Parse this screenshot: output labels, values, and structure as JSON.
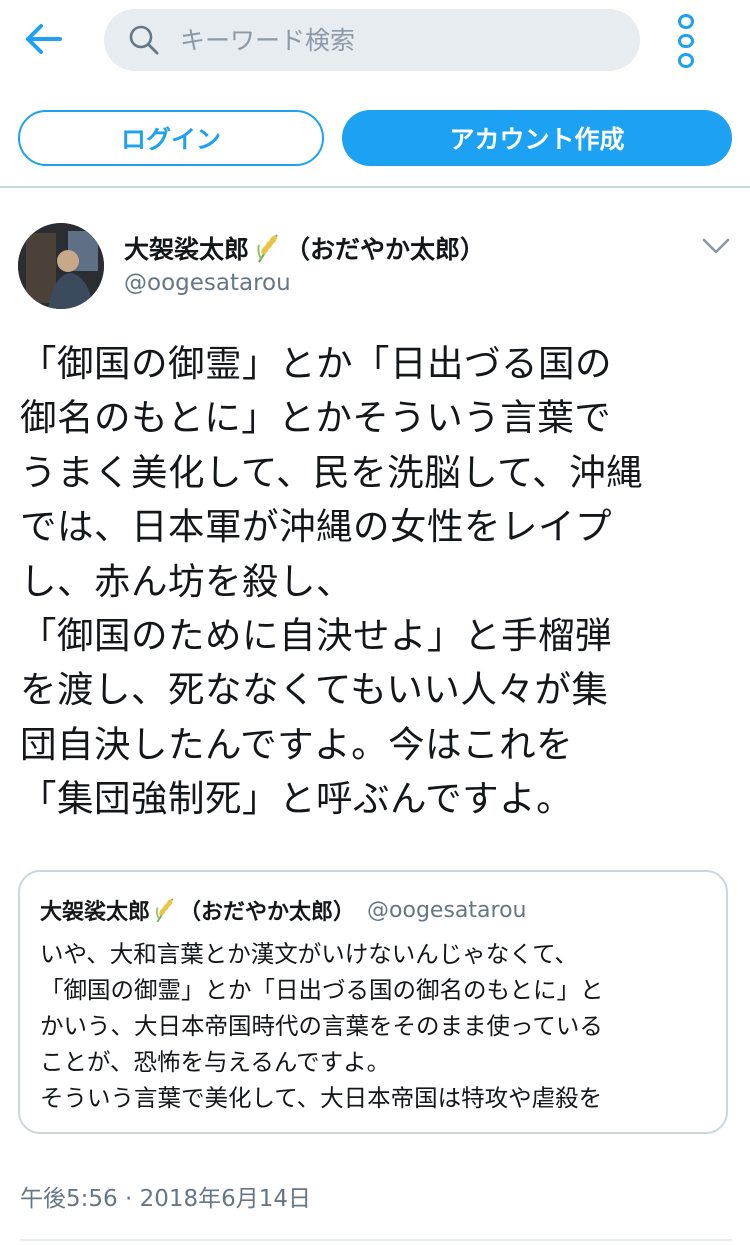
{
  "search": {
    "placeholder": "キーワード検索"
  },
  "auth": {
    "login_label": "ログイン",
    "signup_label": "アカウント作成"
  },
  "tweet": {
    "author_name": "大袈裟太郎",
    "author_name_suffix": "（おだやか太郎）",
    "author_handle": "@oogesatarou",
    "text": "「御国の御霊」とか「日出づる国の\n御名のもとに」とかそういう言葉で\nうまく美化して、民を洗脳して、沖縄\nでは、日本軍が沖縄の女性をレイプ\nし、赤ん坊を殺し、\n「御国のために自決せよ」と手榴弾\nを渡し、死ななくてもいい人々が集\n団自決したんですよ。今はこれを\n「集団強制死」と呼ぶんですよ。",
    "timestamp": "午後5:56 · 2018年6月14日"
  },
  "quoted_tweet": {
    "author_name": "大袈裟太郎",
    "author_name_suffix": "（おだやか太郎）",
    "author_handle": "@oogesatarou",
    "text": "いや、大和言葉とか漢文がいけないんじゃなくて、\n「御国の御霊」とか「日出づる国の御名のもとに」と\nかいう、大日本帝国時代の言葉をそのまま使っている\nことが、恐怖を与えるんですよ。\nそういう言葉で美化して、大日本帝国は特攻や虐殺を"
  },
  "icons": {
    "back": "back-arrow-icon",
    "search": "search-icon",
    "more": "more-vertical-icon",
    "caret": "chevron-down-icon",
    "emoji": "rice-plant-emoji"
  },
  "colors": {
    "accent": "#1da1f2",
    "text_primary": "#14171a",
    "text_secondary": "#657786",
    "search_bg": "#e6ecf0",
    "border": "#ccd6dd"
  }
}
